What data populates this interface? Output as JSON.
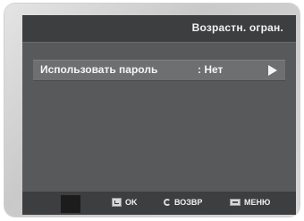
{
  "title_bar": {
    "title": "Возрастн. огран."
  },
  "menu": {
    "items": [
      {
        "label": "Использовать пароль",
        "value": ": Нет",
        "icon": "arrow-right-icon"
      }
    ]
  },
  "bottom_bar": {
    "hints": [
      {
        "icon": "ok-icon",
        "label": "OK"
      },
      {
        "icon": "back-icon",
        "label": "ВОЗВР"
      },
      {
        "icon": "menu-icon",
        "label": "МЕНЮ"
      }
    ]
  },
  "colors": {
    "screen_bg": "#58595b",
    "bar_bg": "#3d3e40",
    "highlight_bg": "#6e6f71",
    "text": "#f5f5f5"
  }
}
